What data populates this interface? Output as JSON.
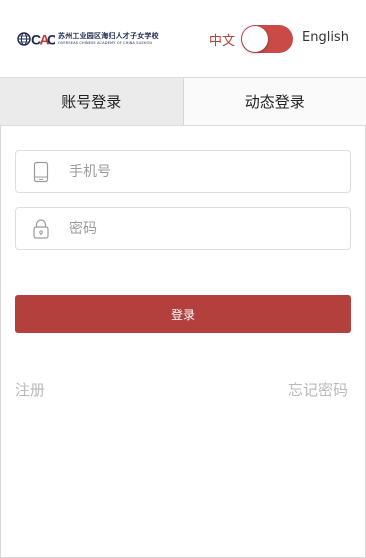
{
  "header": {
    "logo": {
      "mark_text": "CAC",
      "name_cn": "苏州工业园区海归人才子女学校",
      "name_en": "OVERSEAS CHINESE ACADEMY OF CHINA SUZHOU"
    },
    "lang_cn": "中文",
    "lang_en": "English",
    "toggle_color": "#c94a47"
  },
  "tabs": [
    {
      "label": "账号登录",
      "active": true
    },
    {
      "label": "动态登录",
      "active": false
    }
  ],
  "form": {
    "phone_placeholder": "手机号",
    "password_placeholder": "密码",
    "login_label": "登录"
  },
  "links": {
    "register": "注册",
    "forgot_password": "忘记密码"
  },
  "colors": {
    "accent": "#b3403c",
    "muted_text": "#b9b9b9"
  }
}
